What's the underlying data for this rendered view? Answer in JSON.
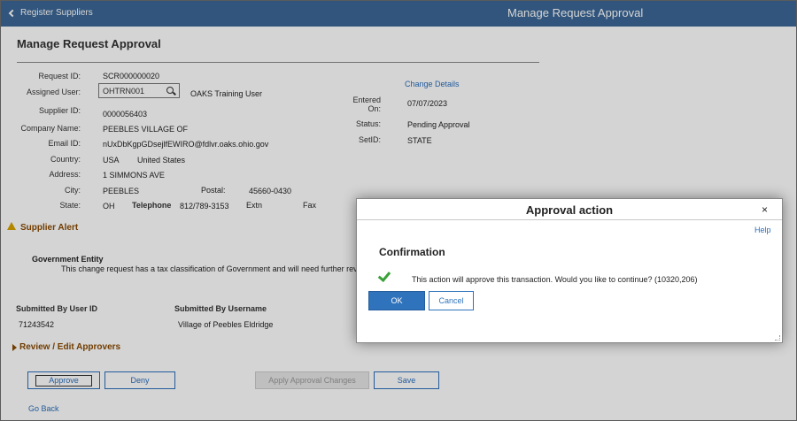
{
  "header": {
    "back_label": "Register Suppliers",
    "title": "Manage Request Approval"
  },
  "page": {
    "title": "Manage Request Approval"
  },
  "form": {
    "request_id_label": "Request ID:",
    "request_id": "SCR000000020",
    "assigned_user_label": "Assigned User:",
    "assigned_user": "OHTRN001",
    "assigned_user_name": "OAKS Training User",
    "supplier_id_label": "Supplier ID:",
    "supplier_id": "0000056403",
    "company_name_label": "Company Name:",
    "company_name": "PEEBLES VILLAGE OF",
    "email_id_label": "Email ID:",
    "email_id": "nUxDbKgpGDsejlfEWIRO@fdlvr.oaks.ohio.gov",
    "country_label": "Country:",
    "country_code": "USA",
    "country_name": "United States",
    "address_label": "Address:",
    "address": "1 SIMMONS AVE",
    "city_label": "City:",
    "city": "PEEBLES",
    "postal_label": "Postal:",
    "postal": "45660-0430",
    "state_label": "State:",
    "state": "OH",
    "telephone_label": "Telephone",
    "telephone": "812/789-3153",
    "extn_label": "Extn",
    "fax_label": "Fax",
    "change_details": "Change Details",
    "entered_on_label_1": "Entered",
    "entered_on_label_2": "On:",
    "entered_on": "07/07/2023",
    "status_label": "Status:",
    "status": "Pending Approval",
    "setid_label": "SetID:",
    "setid": "STATE"
  },
  "alert": {
    "title": "Supplier Alert",
    "gov_title": "Government Entity",
    "gov_text": "This change request has a tax classification of Government and will need further review"
  },
  "submitted": {
    "user_id_label": "Submitted By User ID",
    "user_id": "71243542",
    "username_label": "Submitted By Username",
    "username": "Village of Peebles Eldridge"
  },
  "review": {
    "title": "Review / Edit Approvers"
  },
  "buttons": {
    "approve": "Approve",
    "deny": "Deny",
    "apply_changes": "Apply Approval Changes",
    "save": "Save",
    "go_back": "Go Back"
  },
  "modal": {
    "title": "Approval action",
    "close": "×",
    "help": "Help",
    "confirmation": "Confirmation",
    "message": "This action will approve this transaction. Would you like to continue? (10320,206)",
    "ok": "OK",
    "cancel": "Cancel"
  },
  "colors": {
    "header": "#3c6796",
    "accent": "#2f73bd",
    "alert": "#d8a200",
    "section": "#8a4a00",
    "check": "#3aa13a"
  }
}
